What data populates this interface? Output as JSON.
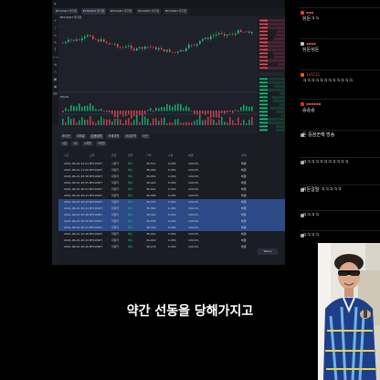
{
  "colors": {
    "up": "#0ecb81",
    "down": "#f6465d",
    "highlight": "#2b4a86",
    "chat_name": "#e05060"
  },
  "trade": {
    "tabs": [
      "BTCUSDT 무기한",
      "ETHUSDT 무기한",
      "BTCUSDT 무기한",
      "BTCUSDT 무기한",
      "BTCUSDT 무기한"
    ],
    "chart_label": "BTCUSDT 무기한",
    "macd_label": "MACD",
    "buy_label": "매수",
    "sell_label": "매도",
    "table_filters": [
      "포지션",
      "미체결",
      "주문내역",
      "거래내역",
      "자금내역",
      "자산"
    ],
    "table_subfilters": [
      "1일",
      "1주",
      "1개월",
      "3개월"
    ],
    "columns": [
      "시간",
      "심볼",
      "유형",
      "방향",
      "가격",
      "수량",
      "체결",
      "상태"
    ],
    "rows": [
      {
        "time": "2021-06-01 21:01",
        "sym": "BTCUSDT",
        "type": "시장가",
        "side": "매수",
        "price": "36,511",
        "qty": "0.050",
        "fill": "100.0%",
        "st": "체결",
        "hl": false
      },
      {
        "time": "2021-06-01 21:00",
        "sym": "BTCUSDT",
        "type": "지정가",
        "side": "매수",
        "price": "36,480",
        "qty": "0.050",
        "fill": "100.0%",
        "st": "체결",
        "hl": false
      },
      {
        "time": "2021-06-01 20:58",
        "sym": "BTCUSDT",
        "type": "지정가",
        "side": "매수",
        "price": "36,452",
        "qty": "0.050",
        "fill": "100.0%",
        "st": "체결",
        "hl": false
      },
      {
        "time": "2021-06-01 20:55",
        "sym": "BTCUSDT",
        "type": "지정가",
        "side": "매수",
        "price": "36,420",
        "qty": "0.050",
        "fill": "100.0%",
        "st": "체결",
        "hl": false
      },
      {
        "time": "2021-06-01 20:51",
        "sym": "BTCUSDT",
        "type": "지정가",
        "side": "매수",
        "price": "36,401",
        "qty": "0.050",
        "fill": "100.0%",
        "st": "체결",
        "hl": false
      },
      {
        "time": "2021-06-01 20:47",
        "sym": "BTCUSDT",
        "type": "지정가",
        "side": "매수",
        "price": "36,388",
        "qty": "0.050",
        "fill": "100.0%",
        "st": "체결",
        "hl": false
      },
      {
        "time": "2021-06-01 20:44",
        "sym": "BTCUSDT",
        "type": "지정가",
        "side": "매수",
        "price": "36,375",
        "qty": "0.050",
        "fill": "100.0%",
        "st": "체결",
        "hl": true
      },
      {
        "time": "2021-06-01 20:41",
        "sym": "BTCUSDT",
        "type": "지정가",
        "side": "매수",
        "price": "36,360",
        "qty": "0.050",
        "fill": "100.0%",
        "st": "체결",
        "hl": true
      },
      {
        "time": "2021-06-01 20:38",
        "sym": "BTCUSDT",
        "type": "지정가",
        "side": "매수",
        "price": "36,342",
        "qty": "0.050",
        "fill": "100.0%",
        "st": "체결",
        "hl": true
      },
      {
        "time": "2021-06-01 20:35",
        "sym": "BTCUSDT",
        "type": "지정가",
        "side": "매수",
        "price": "36,330",
        "qty": "0.050",
        "fill": "100.0%",
        "st": "체결",
        "hl": true
      },
      {
        "time": "2021-06-01 20:31",
        "sym": "BTCUSDT",
        "type": "지정가",
        "side": "매수",
        "price": "36,318",
        "qty": "0.050",
        "fill": "100.0%",
        "st": "체결",
        "hl": true
      },
      {
        "time": "2021-06-01 20:28",
        "sym": "BTCUSDT",
        "type": "지정가",
        "side": "매수",
        "price": "36,301",
        "qty": "0.050",
        "fill": "100.0%",
        "st": "체결",
        "hl": false
      },
      {
        "time": "2021-06-01 20:24",
        "sym": "BTCUSDT",
        "type": "지정가",
        "side": "매수",
        "price": "36,290",
        "qty": "0.050",
        "fill": "100.0%",
        "st": "체결",
        "hl": false
      },
      {
        "time": "2021-06-01 20:20",
        "sym": "BTCUSDT",
        "type": "지정가",
        "side": "매수",
        "price": "36,276",
        "qty": "0.050",
        "fill": "100.0%",
        "st": "체결",
        "hl": false
      }
    ],
    "pager_label": "Tables"
  },
  "chat": [
    {
      "name": "▪▪▪",
      "text": "뒤돈ㅋㅋ"
    },
    {
      "name": "▪▪▪▪",
      "text": "뒤돈뒤돈"
    },
    {
      "name": "1e1111",
      "text": "ㅋㅋㅋㅋㅋㅋㅋㅋㅋㅋㅋㅋ"
    },
    {
      "name": "▪▪▪▪▪▪",
      "text": "숭숭숭"
    },
    {
      "name": "",
      "text": "돈 중꿈꾼해 방송"
    },
    {
      "name": "",
      "text": "ㅋㅋㅋㅋㅋㅋㅋㅋㅋㅋㅋ"
    },
    {
      "name": "",
      "text": "뒤돈갈릴 ㅋㅋㅋㅋㅋ"
    },
    {
      "name": "",
      "text": "ㅋㅋㅋㅋ"
    },
    {
      "name": "",
      "text": "ㅋㅋㅋㅋ"
    }
  ],
  "subtitle": "약간 선동을 당해가지고"
}
